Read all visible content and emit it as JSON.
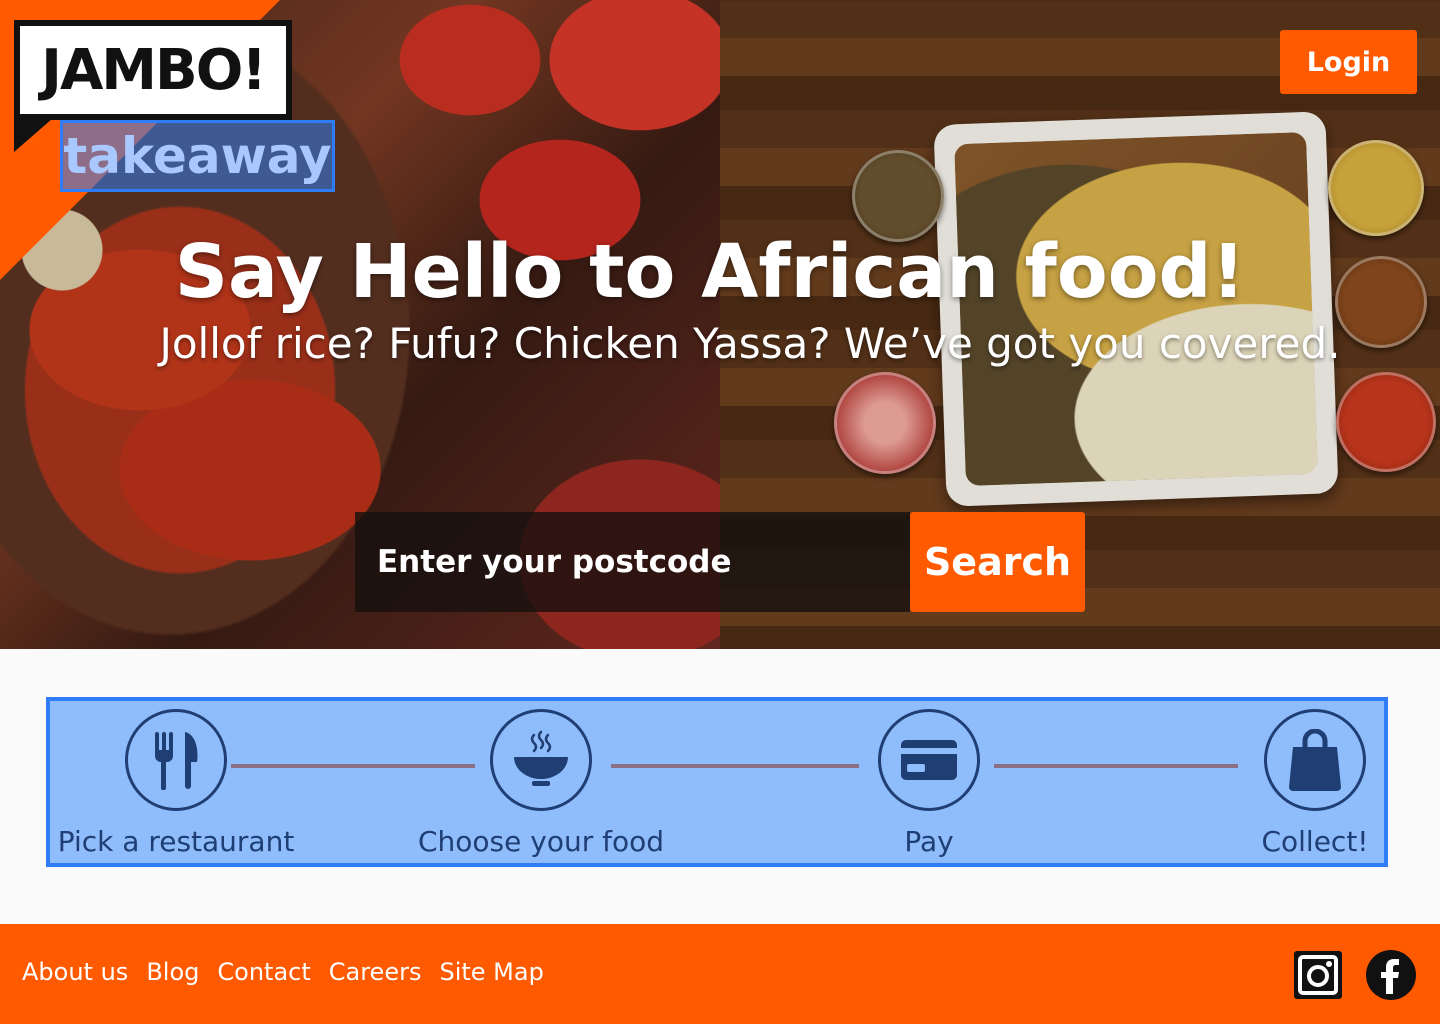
{
  "brand": {
    "logo_text": "JAMBO!",
    "sub_text": "takeaway",
    "accent_color": "#ff5a00"
  },
  "header": {
    "login_label": "Login"
  },
  "hero": {
    "title": "Say Hello to African food!",
    "subtitle": "Jollof rice? Fufu? Chicken Yassa? We’ve got you covered.",
    "search_placeholder": "Enter your postcode",
    "search_label": "Search"
  },
  "steps": [
    {
      "label": "Pick a restaurant",
      "icon": "fork-knife-icon"
    },
    {
      "label": "Choose your food",
      "icon": "steaming-bowl-icon"
    },
    {
      "label": "Pay",
      "icon": "credit-card-icon"
    },
    {
      "label": "Collect!",
      "icon": "bag-icon"
    }
  ],
  "footer": {
    "links": [
      "About us",
      "Blog",
      "Contact",
      "Careers",
      "Site Map"
    ],
    "social": [
      "instagram-icon",
      "facebook-icon"
    ]
  }
}
